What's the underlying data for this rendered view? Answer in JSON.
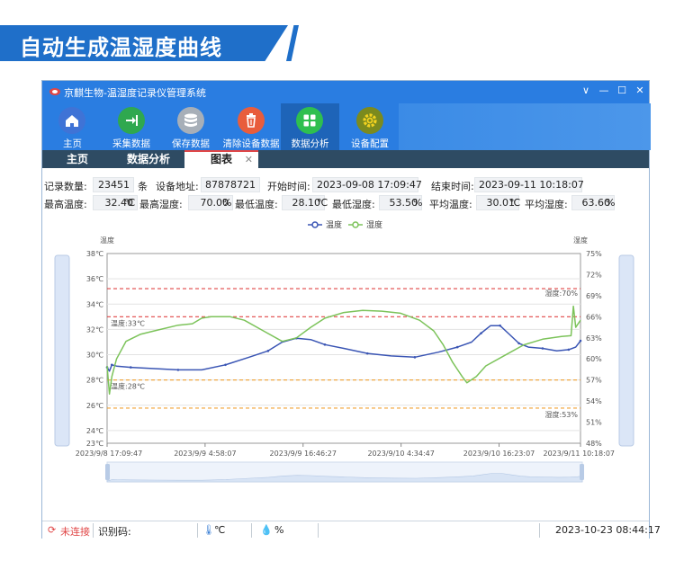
{
  "banner": {
    "title": "自动生成温湿度曲线"
  },
  "window": {
    "title": "京麒生物-温湿度记录仪管理系统",
    "controls": [
      "∨",
      "—",
      "☐",
      "✕"
    ]
  },
  "toolbar": {
    "items": [
      {
        "label": "主页",
        "icon": "home-icon",
        "color": "#3f73d6"
      },
      {
        "label": "采集数据",
        "icon": "import-icon",
        "color": "#2fa84f"
      },
      {
        "label": "保存数据",
        "icon": "database-icon",
        "color": "#a7afb8"
      },
      {
        "label": "清除设备数据",
        "icon": "trash-icon",
        "color": "#e85d3c"
      },
      {
        "label": "数据分析",
        "icon": "grid-icon",
        "color": "#2fbf4f"
      },
      {
        "label": "设备配置",
        "icon": "gear-icon",
        "color": "#7b8a1e"
      }
    ]
  },
  "tabs": [
    {
      "label": "主页"
    },
    {
      "label": "数据分析"
    },
    {
      "label": "图表",
      "close": "✕"
    }
  ],
  "record": {
    "count_label": "记录数量:",
    "count_value": "23451",
    "count_unit": "条",
    "addr_label": "设备地址:",
    "addr_value": "87878721",
    "start_label": "开始时间:",
    "start_value": "2023-09-08 17:09:47",
    "end_label": "结束时间:",
    "end_value": "2023-09-11 10:18:07"
  },
  "stats": {
    "max_temp_label": "最高温度:",
    "max_temp_value": "32.40",
    "temp_unit": "℃",
    "max_hum_label": "最高湿度:",
    "max_hum_value": "70.00",
    "hum_unit": "%",
    "min_temp_label": "最低温度:",
    "min_temp_value": "28.10",
    "min_hum_label": "最低湿度:",
    "min_hum_value": "53.50",
    "avg_temp_label": "平均温度:",
    "avg_temp_value": "30.01",
    "avg_hum_label": "平均湿度:",
    "avg_hum_value": "63.60"
  },
  "chart_data": {
    "type": "line",
    "y_left_label": "温度",
    "y_right_label": "湿度",
    "y_left_ticks": [
      "38℃",
      "36℃",
      "34℃",
      "32℃",
      "30℃",
      "28℃",
      "26℃",
      "24℃",
      "23℃"
    ],
    "y_left_values": [
      38,
      36,
      34,
      32,
      30,
      28,
      26,
      24,
      23
    ],
    "y_right_ticks": [
      "75%",
      "72%",
      "69%",
      "66%",
      "63%",
      "60%",
      "57%",
      "54%",
      "51%",
      "48%"
    ],
    "ylim_left": [
      23,
      38
    ],
    "ylim_right": [
      48,
      75
    ],
    "x_ticks": [
      "2023/9/8 17:09:47",
      "2023/9/9 4:58:07",
      "2023/9/9 16:46:27",
      "2023/9/10 4:34:47",
      "2023/9/10 16:23:07",
      "2023/9/11 10:18:07"
    ],
    "grid": true,
    "legend_position": "top-center",
    "series": [
      {
        "name": "温度",
        "axis": "left",
        "color": "#3a55b4",
        "points": [
          [
            0.0,
            29.0
          ],
          [
            0.005,
            28.7
          ],
          [
            0.01,
            29.2
          ],
          [
            0.02,
            29.1
          ],
          [
            0.05,
            29.0
          ],
          [
            0.1,
            28.9
          ],
          [
            0.15,
            28.8
          ],
          [
            0.2,
            28.8
          ],
          [
            0.25,
            29.2
          ],
          [
            0.3,
            29.8
          ],
          [
            0.34,
            30.3
          ],
          [
            0.37,
            31.0
          ],
          [
            0.4,
            31.3
          ],
          [
            0.43,
            31.2
          ],
          [
            0.46,
            30.8
          ],
          [
            0.5,
            30.5
          ],
          [
            0.55,
            30.1
          ],
          [
            0.6,
            29.9
          ],
          [
            0.65,
            29.8
          ],
          [
            0.7,
            30.2
          ],
          [
            0.74,
            30.6
          ],
          [
            0.77,
            31.0
          ],
          [
            0.79,
            31.7
          ],
          [
            0.81,
            32.3
          ],
          [
            0.83,
            32.3
          ],
          [
            0.85,
            31.6
          ],
          [
            0.87,
            30.9
          ],
          [
            0.89,
            30.6
          ],
          [
            0.92,
            30.5
          ],
          [
            0.95,
            30.3
          ],
          [
            0.975,
            30.4
          ],
          [
            0.99,
            30.6
          ],
          [
            1.0,
            31.1
          ]
        ]
      },
      {
        "name": "湿度",
        "axis": "right",
        "color": "#7cc35a",
        "points": [
          [
            0.0,
            59.0
          ],
          [
            0.005,
            55.0
          ],
          [
            0.01,
            57.5
          ],
          [
            0.02,
            60.0
          ],
          [
            0.04,
            62.5
          ],
          [
            0.07,
            63.5
          ],
          [
            0.1,
            64.0
          ],
          [
            0.15,
            64.8
          ],
          [
            0.18,
            65.0
          ],
          [
            0.2,
            65.8
          ],
          [
            0.22,
            66.0
          ],
          [
            0.26,
            66.0
          ],
          [
            0.29,
            65.5
          ],
          [
            0.33,
            64.0
          ],
          [
            0.37,
            62.5
          ],
          [
            0.4,
            63.0
          ],
          [
            0.43,
            64.5
          ],
          [
            0.46,
            65.8
          ],
          [
            0.5,
            66.6
          ],
          [
            0.54,
            66.9
          ],
          [
            0.58,
            66.8
          ],
          [
            0.62,
            66.5
          ],
          [
            0.66,
            65.5
          ],
          [
            0.69,
            64.0
          ],
          [
            0.71,
            62.0
          ],
          [
            0.73,
            59.5
          ],
          [
            0.75,
            57.5
          ],
          [
            0.76,
            56.6
          ],
          [
            0.78,
            57.5
          ],
          [
            0.8,
            59.0
          ],
          [
            0.84,
            60.5
          ],
          [
            0.88,
            62.0
          ],
          [
            0.92,
            62.8
          ],
          [
            0.96,
            63.2
          ],
          [
            0.98,
            63.3
          ],
          [
            0.985,
            67.5
          ],
          [
            0.99,
            64.5
          ],
          [
            1.0,
            65.5
          ]
        ]
      }
    ],
    "reference_lines": [
      {
        "label": "温度:33℃",
        "axis": "left",
        "value": 33,
        "color": "#e04646",
        "style": "dashed"
      },
      {
        "label": "温度:28℃",
        "axis": "left",
        "value": 28,
        "color": "#f0a030",
        "style": "dashed"
      },
      {
        "label": "湿度:70%",
        "axis": "right",
        "value": 70,
        "color": "#e04646",
        "style": "dashed"
      },
      {
        "label": "湿度:53%",
        "axis": "right",
        "value": 53,
        "color": "#f0a030",
        "style": "dashed"
      }
    ]
  },
  "status": {
    "connection": "未连接",
    "id_label": "识别码:",
    "temp_unit": "℃",
    "hum_unit": "%",
    "datetime": "2023-10-23 08:44:17"
  }
}
